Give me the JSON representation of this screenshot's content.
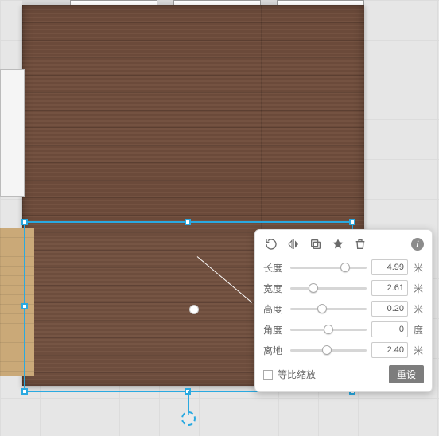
{
  "panel": {
    "props": [
      {
        "label": "长度",
        "value": "4.99",
        "unit": "米",
        "percent": 72
      },
      {
        "label": "宽度",
        "value": "2.61",
        "unit": "米",
        "percent": 30
      },
      {
        "label": "高度",
        "value": "0.20",
        "unit": "米",
        "percent": 42
      },
      {
        "label": "角度",
        "value": "0",
        "unit": "度",
        "percent": 50
      },
      {
        "label": "离地",
        "value": "2.40",
        "unit": "米",
        "percent": 48
      }
    ],
    "proportional_label": "等比缩放",
    "reset_label": "重设",
    "info_glyph": "i"
  },
  "toolbar_icons": {
    "rotate": "rotate-icon",
    "flip_h": "flip-horizontal-icon",
    "copy": "copy-icon",
    "favorite": "star-icon",
    "delete": "trash-icon",
    "info": "info-icon"
  }
}
